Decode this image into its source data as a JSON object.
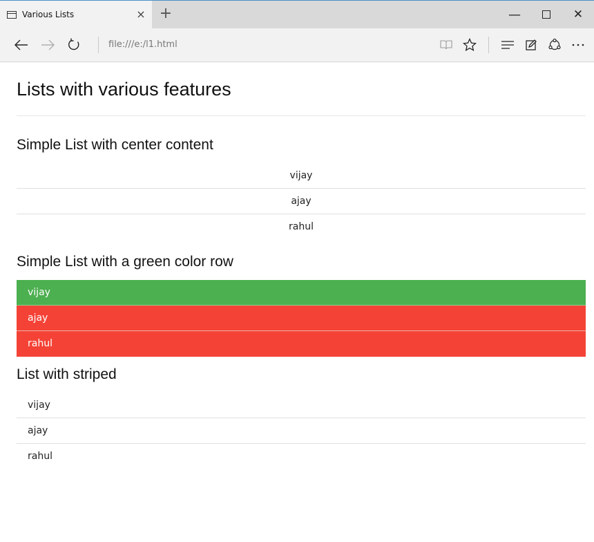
{
  "browser": {
    "tab_title": "Various Lists",
    "tab_close": "×",
    "new_tab": "+",
    "address": "file:///e:/l1.html",
    "window_controls": {
      "minimize": "—",
      "close": "✕"
    }
  },
  "icons": {
    "back": "back-arrow-icon",
    "forward": "forward-arrow-icon",
    "refresh": "refresh-icon",
    "reading_view": "book-icon",
    "favorite": "star-icon",
    "hub": "hub-icon",
    "web_note": "pen-icon",
    "share": "share-icon",
    "more": "more-icon"
  },
  "page": {
    "heading": "Lists with various features",
    "sections": [
      {
        "title": "Simple List with center content",
        "items": [
          "vijay",
          "ajay",
          "rahul"
        ]
      },
      {
        "title": "Simple List with a green color row",
        "items": [
          "vijay",
          "ajay",
          "rahul"
        ]
      },
      {
        "title": "List with striped",
        "items": [
          "vijay",
          "ajay",
          "rahul"
        ]
      }
    ]
  },
  "colors": {
    "green_row": "#4caf50",
    "red_row": "#f44336"
  }
}
